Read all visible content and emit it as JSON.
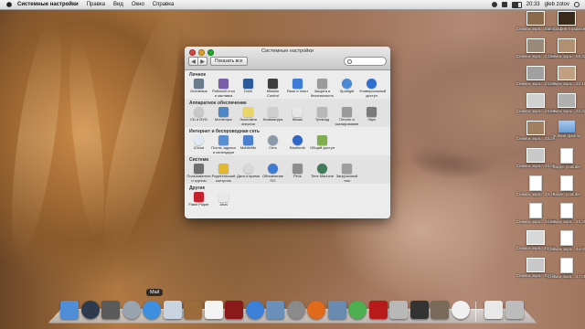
{
  "menubar": {
    "app": "Системные настройки",
    "items": [
      "Правка",
      "Вид",
      "Окно",
      "Справка"
    ],
    "clock": "20:33",
    "user": "gleb zotov"
  },
  "window": {
    "title": "Системные настройки",
    "show_all": "Показать все",
    "search_placeholder": "",
    "sections": [
      {
        "title": "Личное",
        "items": [
          {
            "label": "Основные",
            "icon": "general-icon",
            "color": "#6b7b8c"
          },
          {
            "label": "Рабочий стол и заставка",
            "icon": "desktop-icon",
            "color": "#7a5fa8"
          },
          {
            "label": "Dock",
            "icon": "dock-icon",
            "color": "#2c5a9a"
          },
          {
            "label": "Mission Control",
            "icon": "mission-control-icon",
            "color": "#3d3d3d"
          },
          {
            "label": "Язык и текст",
            "icon": "language-icon",
            "color": "#3d7dd8"
          },
          {
            "label": "Защита и безопасность",
            "icon": "security-icon",
            "color": "#9b9b9b"
          },
          {
            "label": "Spotlight",
            "icon": "spotlight-icon",
            "color": "#4a88d8"
          },
          {
            "label": "Универсальный доступ",
            "icon": "accessibility-icon",
            "color": "#2f6fd0"
          }
        ]
      },
      {
        "title": "Аппаратное обеспечение",
        "items": [
          {
            "label": "CD и DVD",
            "icon": "cd-icon",
            "color": "#c8c8c8"
          },
          {
            "label": "Мониторы",
            "icon": "displays-icon",
            "color": "#4f86c6"
          },
          {
            "label": "Экономия энергии",
            "icon": "energy-icon",
            "color": "#e8d66a"
          },
          {
            "label": "Клавиатура",
            "icon": "keyboard-icon",
            "color": "#cfcfcf"
          },
          {
            "label": "Мышь",
            "icon": "mouse-icon",
            "color": "#e6e6e6"
          },
          {
            "label": "Трекпад",
            "icon": "trackpad-icon",
            "color": "#b8b8b8"
          },
          {
            "label": "Печать и сканирование",
            "icon": "print-icon",
            "color": "#9a9a9a"
          },
          {
            "label": "Звук",
            "icon": "sound-icon",
            "color": "#7a7a7a"
          }
        ]
      },
      {
        "title": "Интернет и беспроводная сеть",
        "items": [
          {
            "label": "iCloud",
            "icon": "icloud-icon",
            "color": "#dfe8f3"
          },
          {
            "label": "Почта, адреса и календари",
            "icon": "mail-contacts-icon",
            "color": "#5b8fd4"
          },
          {
            "label": "MobileMe",
            "icon": "mobileme-icon",
            "color": "#4a7fcf"
          },
          {
            "label": "Сеть",
            "icon": "network-icon",
            "color": "#8a9aa9"
          },
          {
            "label": "Bluetooth",
            "icon": "bluetooth-icon",
            "color": "#2f67c9"
          },
          {
            "label": "Общий доступ",
            "icon": "sharing-icon",
            "color": "#7fae4e"
          }
        ]
      },
      {
        "title": "Система",
        "items": [
          {
            "label": "Пользователи и группы",
            "icon": "users-icon",
            "color": "#6f6f6f"
          },
          {
            "label": "Родительский контроль",
            "icon": "parental-icon",
            "color": "#e3b82e"
          },
          {
            "label": "Дата и время",
            "icon": "date-time-icon",
            "color": "#d8d8d8"
          },
          {
            "label": "Обновление ПО",
            "icon": "software-update-icon",
            "color": "#3d7bd4"
          },
          {
            "label": "Речь",
            "icon": "speech-icon",
            "color": "#8d8d8d"
          },
          {
            "label": "Time Machine",
            "icon": "time-machine-icon",
            "color": "#3f7c5a"
          },
          {
            "label": "Загрузочный том",
            "icon": "startup-disk-icon",
            "color": "#9e9e9e"
          }
        ]
      },
      {
        "title": "Другие",
        "items": [
          {
            "label": "Flash Player",
            "icon": "flash-icon",
            "color": "#c8202a"
          },
          {
            "label": "Java",
            "icon": "java-icon",
            "color": "#e8e8e8"
          }
        ]
      }
    ]
  },
  "desktop_items": [
    {
      "label": "Снимок экра....58.34",
      "kind": "thumb",
      "color": "#8a6a4a"
    },
    {
      "label": "биография в кармане",
      "kind": "thumb",
      "color": "#3a2a1a"
    },
    {
      "label": "Снимок экра....44.54",
      "kind": "thumb",
      "color": "#9a8a7a"
    },
    {
      "label": "Снимок экра....59.32",
      "kind": "thumb",
      "color": "#b09070"
    },
    {
      "label": "Снимок экра....45.09",
      "kind": "thumb",
      "color": "#a0a0a0"
    },
    {
      "label": "Снимок экра....32.15",
      "kind": "thumb",
      "color": "#c0a080"
    },
    {
      "label": "Снимок экра....45.15",
      "kind": "thumb",
      "color": "#d0d0d0"
    },
    {
      "label": "Снимок экра....32.32",
      "kind": "thumb",
      "color": "#b0b0b0"
    },
    {
      "label": "Снимок экра....45.29",
      "kind": "thumb",
      "color": "#a08060"
    },
    {
      "label": "всякие файлы",
      "kind": "folder",
      "color": "#7aa8dd"
    },
    {
      "label": "Снимок экра....45.35",
      "kind": "thumb",
      "color": "#c8c8c8"
    },
    {
      "label": "видео youtube",
      "kind": "doc",
      "color": "#ffffff"
    },
    {
      "label": "Снимок экра....45.45",
      "kind": "doc",
      "color": "#ffffff"
    },
    {
      "label": "видео youtube",
      "kind": "doc",
      "color": "#ffffff"
    },
    {
      "label": "Снимок экра....45.58",
      "kind": "doc",
      "color": "#ffffff"
    },
    {
      "label": "Снимок экра....46.20",
      "kind": "doc",
      "color": "#ffffff"
    },
    {
      "label": "Снимок экра....51.50",
      "kind": "thumb",
      "color": "#d8d8d8"
    },
    {
      "label": "Снимок экра....46.20",
      "kind": "doc",
      "color": "#ffffff"
    },
    {
      "label": "Снимок экра....52.00",
      "kind": "thumb",
      "color": "#c8c8c8"
    },
    {
      "label": "Снимок экра....47.08",
      "kind": "doc",
      "color": "#ffffff"
    }
  ],
  "dock": {
    "tooltip": "Mail",
    "apps": [
      {
        "name": "finder-icon",
        "color": "#4f8ed6",
        "round": false
      },
      {
        "name": "dashboard-icon",
        "color": "#2e3a4e",
        "round": true
      },
      {
        "name": "mission-control-dock-icon",
        "color": "#5a5a5a",
        "round": false
      },
      {
        "name": "launchpad-icon",
        "color": "#9aa4b0",
        "round": true
      },
      {
        "name": "app-store-icon",
        "color": "#3d8fe0",
        "round": true
      },
      {
        "name": "mail-icon",
        "color": "#c8d4e0",
        "round": false
      },
      {
        "name": "address-book-icon",
        "color": "#9b6b3a",
        "round": false
      },
      {
        "name": "calendar-icon",
        "color": "#f3f3f3",
        "round": false
      },
      {
        "name": "photo-booth-icon",
        "color": "#8a1a1a",
        "round": false
      },
      {
        "name": "itunes-icon",
        "color": "#3a7fd8",
        "round": true
      },
      {
        "name": "preview-icon",
        "color": "#6a8fb8",
        "round": false
      },
      {
        "name": "system-preferences-dock-icon",
        "color": "#8a8a8a",
        "round": true
      },
      {
        "name": "firefox-icon",
        "color": "#e06a1a",
        "round": true
      },
      {
        "name": "photos-icon",
        "color": "#6a8ab0",
        "round": false
      },
      {
        "name": "chrome-icon",
        "color": "#4caf50",
        "round": true
      },
      {
        "name": "flash-dock-icon",
        "color": "#b81a1a",
        "round": false
      },
      {
        "name": "utility-icon",
        "color": "#b8b8b8",
        "round": false
      },
      {
        "name": "terminal-icon",
        "color": "#333333",
        "round": false
      },
      {
        "name": "iphoto-icon",
        "color": "#7a6a5a",
        "round": false
      },
      {
        "name": "sheep-icon",
        "color": "#f0f0f0",
        "round": true
      },
      {
        "name": "documents-stack-icon",
        "color": "#e8e8e8",
        "round": false
      },
      {
        "name": "trash-icon",
        "color": "#bcbcbc",
        "round": false
      }
    ]
  }
}
